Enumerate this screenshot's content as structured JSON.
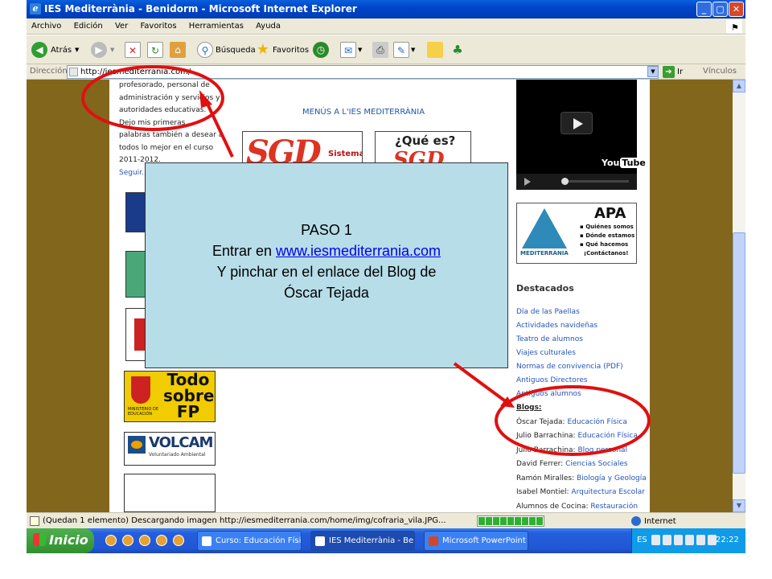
{
  "window": {
    "title": "IES Mediterrània - Benidorm - Microsoft Internet Explorer",
    "buttons": [
      "_",
      "▢",
      "✕"
    ]
  },
  "menubar": [
    "Archivo",
    "Edición",
    "Ver",
    "Favoritos",
    "Herramientas",
    "Ayuda"
  ],
  "toolbar": {
    "back_label": "Atrás",
    "search_label": "Búsqueda",
    "favorites_label": "Favoritos"
  },
  "address": {
    "label": "Dirección",
    "url": "http://iesmediterrania.com/",
    "go_label": "Ir",
    "links_label": "Vínculos"
  },
  "page": {
    "left_text": [
      "profesorado, personal de",
      "administración y servicios y",
      "autoridades educativas.",
      "Dejo mis primeras",
      "palabras también a desear a",
      "todos lo mejor en el curso",
      "2011-2012."
    ],
    "left_more": "Seguir...",
    "menus_title": "MENÚS A L'IES MEDITERRÀNIA",
    "sgd_text": "SGD",
    "sistema": "Sistema",
    "que_es": "¿Qué es?",
    "youtube": {
      "you": "You",
      "tube": "Tube"
    },
    "apa": {
      "title": "APA",
      "items": [
        "Quiénes somos",
        "Dónde estamos",
        "Qué hacemos",
        "¡Contáctanos!"
      ],
      "logo_text": "MEDITERRÀNIA"
    },
    "destacados_title": "Destacados",
    "destacados": [
      "Día de las Paellas",
      "Actividades navideñas",
      "Teatro de alumnos",
      "Viajes culturales",
      "Normas de convivencia (PDF)",
      "Antiguos Directores",
      "Antiguos alumnos"
    ],
    "blogs_title": "Blogs:",
    "blogs": [
      {
        "person": "Óscar Tejada:",
        "link": "Educación Física"
      },
      {
        "person": "Julio Barrachina:",
        "link": "Educación Física"
      },
      {
        "person": "Julio Barrachina:",
        "link": "Blog personal"
      },
      {
        "person": "David Ferrer:",
        "link": "Ciencias Sociales"
      },
      {
        "person": "Ramón Miralles:",
        "link": "Biología y Geología"
      },
      {
        "person": "Isabel Montiel:",
        "link": "Arquitectura Escolar"
      },
      {
        "person": "Alumnos de Cocina:",
        "link": "Restauración"
      }
    ],
    "todo_fp": [
      "Todo",
      "sobre",
      "FP"
    ],
    "ministerio": "MINISTERIO DE EDUCACIÓN",
    "volcam": "VOLCAM",
    "volcam_sub": "Voluntariado Ambiental"
  },
  "overlay": {
    "line1": "PASO 1",
    "line2_prefix": "Entrar en ",
    "line2_link": "www.iesmediterrania.com",
    "line3": "Y pinchar en el enlace del Blog de",
    "line4": "Óscar Tejada"
  },
  "statusbar": {
    "text": "(Quedan 1 elemento) Descargando imagen http://iesmediterrania.com/home/img/cofraria_vila.JPG...",
    "zone": "Internet"
  },
  "taskbar": {
    "start": "Inicio",
    "tasks": [
      "Curso: Educación Físi...",
      "IES Mediterrània - Be...",
      "Microsoft PowerPoint ..."
    ],
    "lang": "ES",
    "clock": "22:22"
  },
  "colors": {
    "annotation_red": "#e01010",
    "page_bg": "#82661c",
    "overlay_bg": "#b7dde8"
  }
}
